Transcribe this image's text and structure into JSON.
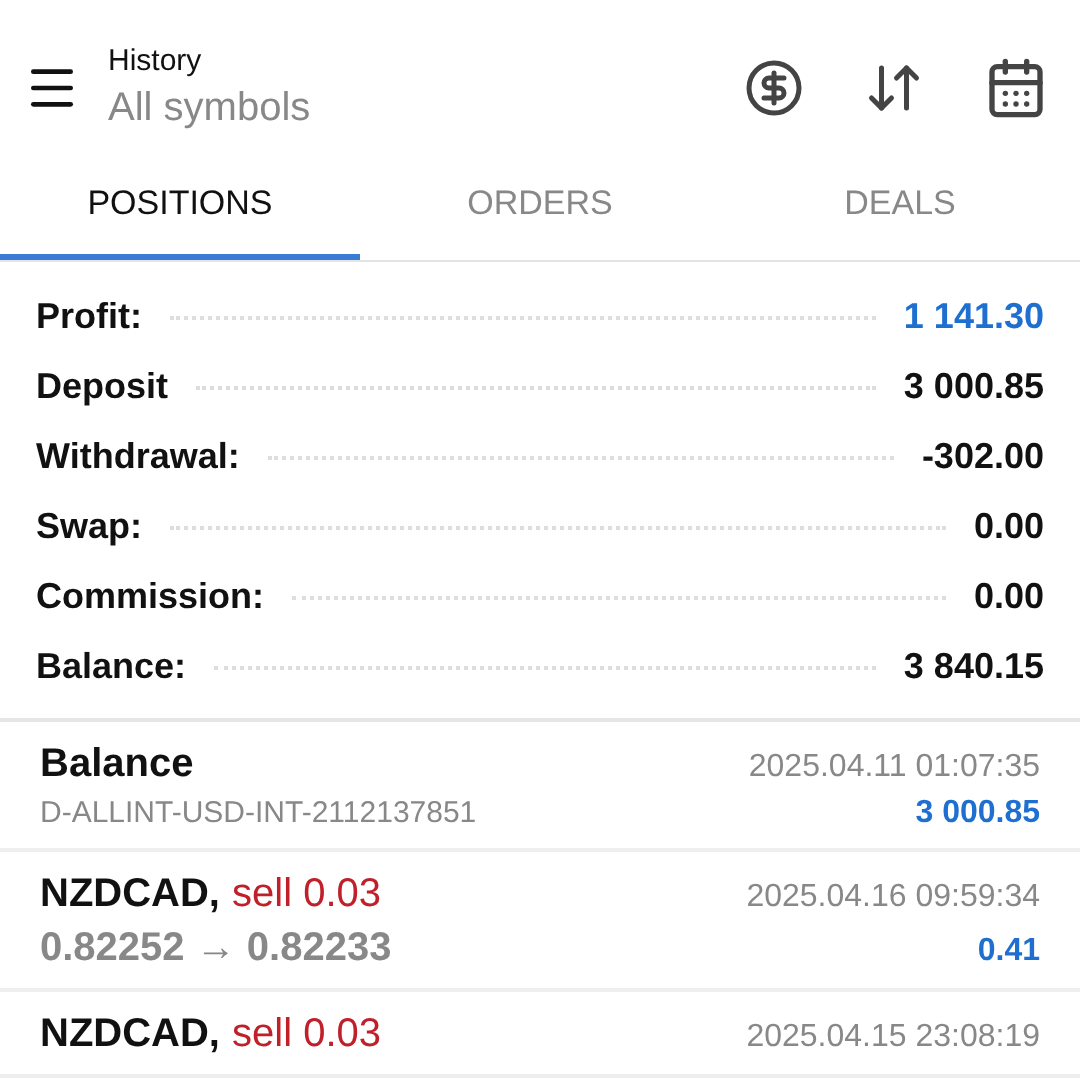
{
  "header": {
    "title": "History",
    "subtitle": "All symbols"
  },
  "tabs": [
    {
      "label": "POSITIONS",
      "selected": true
    },
    {
      "label": "ORDERS",
      "selected": false
    },
    {
      "label": "DEALS",
      "selected": false
    }
  ],
  "summary": [
    {
      "label": "Profit:",
      "value": "1 141.30",
      "highlighted": true
    },
    {
      "label": "Deposit",
      "value": "3 000.85",
      "highlighted": false
    },
    {
      "label": "Withdrawal:",
      "value": "-302.00",
      "highlighted": false
    },
    {
      "label": "Swap:",
      "value": "0.00",
      "highlighted": false
    },
    {
      "label": "Commission:",
      "value": "0.00",
      "highlighted": false
    },
    {
      "label": "Balance:",
      "value": "3 840.15",
      "highlighted": false
    }
  ],
  "deals": [
    {
      "kind": "balance",
      "title": "Balance",
      "time": "2025.04.11 01:07:35",
      "detail": "D-ALLINT-USD-INT-2112137851",
      "amount": "3 000.85"
    },
    {
      "kind": "trade",
      "title": "NZDCAD,",
      "side": "sell 0.03",
      "time": "2025.04.16 09:59:34",
      "detail": "0.82252 → 0.82233",
      "amount": "0.41"
    },
    {
      "kind": "trade",
      "title": "NZDCAD,",
      "side": "sell 0.03",
      "time": "2025.04.15 23:08:19"
    }
  ]
}
